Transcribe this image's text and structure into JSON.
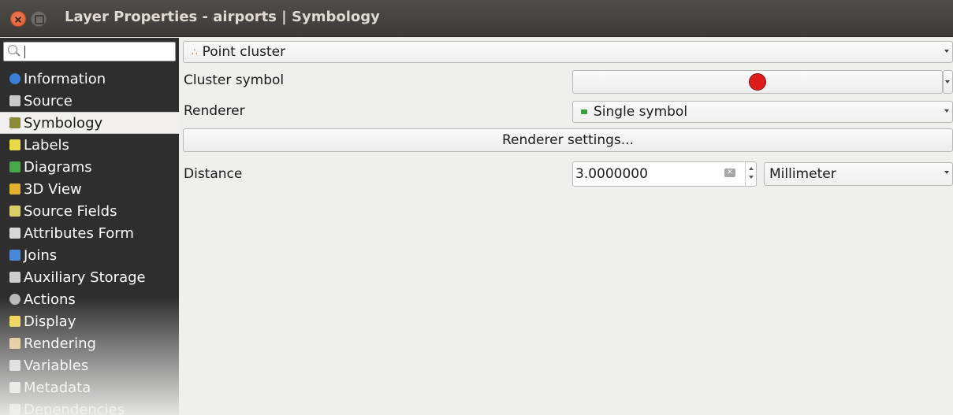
{
  "window": {
    "title": "Layer Properties - airports | Symbology"
  },
  "sidebar": {
    "search_placeholder": "",
    "items": [
      {
        "label": "Information",
        "icon": "info-icon",
        "color": "#3d7fd6"
      },
      {
        "label": "Source",
        "icon": "source-icon",
        "color": "#c8c8c8"
      },
      {
        "label": "Symbology",
        "icon": "paintbrush-icon",
        "color": "#8a8a3a"
      },
      {
        "label": "Labels",
        "icon": "labels-icon",
        "color": "#e8d84a"
      },
      {
        "label": "Diagrams",
        "icon": "diagrams-icon",
        "color": "#4aa84a"
      },
      {
        "label": "3D View",
        "icon": "cube-icon",
        "color": "#e0b030"
      },
      {
        "label": "Source Fields",
        "icon": "fields-icon",
        "color": "#d8d068"
      },
      {
        "label": "Attributes Form",
        "icon": "form-icon",
        "color": "#d8d8d8"
      },
      {
        "label": "Joins",
        "icon": "joins-icon",
        "color": "#4a88d8"
      },
      {
        "label": "Auxiliary Storage",
        "icon": "storage-icon",
        "color": "#cfcfcf"
      },
      {
        "label": "Actions",
        "icon": "actions-icon",
        "color": "#b8b8b8"
      },
      {
        "label": "Display",
        "icon": "display-icon",
        "color": "#f0d048"
      },
      {
        "label": "Rendering",
        "icon": "rendering-icon",
        "color": "#e0c080"
      },
      {
        "label": "Variables",
        "icon": "variables-icon",
        "color": "#cfcfcf"
      },
      {
        "label": "Metadata",
        "icon": "metadata-icon",
        "color": "#e0e0e0"
      },
      {
        "label": "Dependencies",
        "icon": "dependencies-icon",
        "color": "#e0e0e0"
      }
    ],
    "selected": "Symbology"
  },
  "symbology": {
    "renderer_type": "Point cluster",
    "cluster_symbol_label": "Cluster symbol",
    "cluster_symbol_color": "#dd1c1c",
    "renderer_label": "Renderer",
    "renderer_value": "Single symbol",
    "renderer_settings_button": "Renderer settings...",
    "distance_label": "Distance",
    "distance_value": "3.0000000",
    "distance_unit": "Millimeter"
  }
}
